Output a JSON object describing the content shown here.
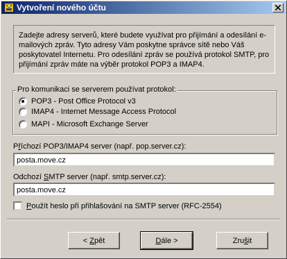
{
  "window": {
    "title": "Vytvoření nového účtu"
  },
  "intro_text": "Zadejte adresy serverů, které budete využívat pro přijímání a odesílání e-mailových zpráv. Tyto adresy Vám poskytne správce sítě nebo Váš poskytovatel Internetu. Pro odesílání zpráv se používá protokol SMTP, pro přijímání zpráv máte na výběr protokol POP3 a IMAP4.",
  "protocol_group": {
    "label": "Pro komunikaci se serverem používat protokol:",
    "options": [
      {
        "label": "POP3 - Post Office Protocol v3",
        "checked": true
      },
      {
        "label": "IMAP4 - Internet Message Access Protocol",
        "checked": false
      },
      {
        "label": "MAPI - Microsoft Exchange Server",
        "checked": false
      }
    ]
  },
  "incoming": {
    "label_prefix": "P",
    "label_underlined": "ř",
    "label_rest": "íchozí POP3/IMAP4 server (např. pop.server.cz):",
    "value": "posta.move.cz"
  },
  "outgoing": {
    "label_prefix": "Odchozí ",
    "label_underlined": "S",
    "label_rest": "MTP server (např. smtp.server.cz):",
    "value": "posta.move.cz"
  },
  "auth_checkbox": {
    "label_underlined": "P",
    "label_rest": "oužít heslo při přihlašování na SMTP server (RFC-2554)",
    "checked": false
  },
  "buttons": {
    "back": {
      "prefix": "< ",
      "underlined": "Z",
      "rest": "pět"
    },
    "next": {
      "underlined": "D",
      "rest": "ále >"
    },
    "cancel": {
      "prefix": "Zru",
      "underlined": "š",
      "rest": "it"
    }
  },
  "colors": {
    "titlebar_start": "#0a246a",
    "titlebar_end": "#a6caf0",
    "face": "#d4d0c8"
  }
}
